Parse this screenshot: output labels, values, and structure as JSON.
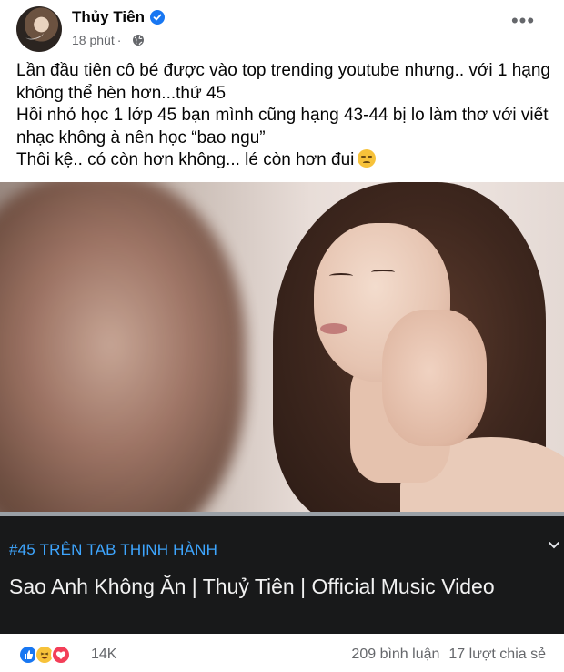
{
  "post": {
    "author": "Thủy Tiên",
    "time": "18 phút",
    "separator": "·",
    "more_label": "•••",
    "text_lines": [
      "Lần đầu tiên cô bé được vào top trending youtube nhưng.. với 1 hạng",
      "không thể hèn hơn...thứ 45",
      "Hồi nhỏ học 1 lớp 45 bạn mình cũng hạng 43-44 bị lo làm thơ với viết",
      "nhạc không à nên học “bao ngu”",
      "Thôi kệ.. có còn hơn không... lé còn hơn đui"
    ],
    "emoji": "pensive-face"
  },
  "video": {
    "trending_tag": "#45 TRÊN TAB THỊNH HÀNH",
    "title": "Sao Anh Không Ăn | Thuỷ Tiên | Official Music Video"
  },
  "footer": {
    "reactions": [
      "like",
      "haha",
      "love"
    ],
    "reaction_count": "14K",
    "comments": "209 bình luận",
    "shares": "17 lượt chia sẻ"
  },
  "colors": {
    "verified": "#1877f2",
    "trending_tag": "#3ea6ff",
    "video_panel": "#18191a",
    "secondary_text": "#65676b"
  }
}
